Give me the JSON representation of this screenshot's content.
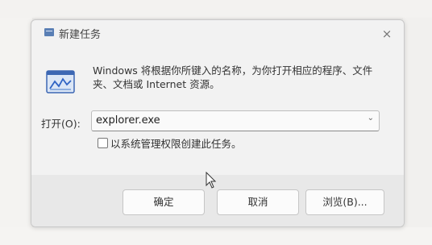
{
  "dialog": {
    "title": "新建任务",
    "close_label": "×",
    "description": "Windows 将根据你所键入的名称，为你打开相应的程序、文件夹、文档或 Internet 资源。",
    "open_label": "打开(O):",
    "open_value": "explorer.exe",
    "admin_checkbox_label": "以系统管理权限创建此任务。",
    "buttons": {
      "ok": "确定",
      "cancel": "取消",
      "browse": "浏览(B)..."
    }
  },
  "colors": {
    "accent": "#2f63c4",
    "dialog_bg": "#f2f2f2"
  },
  "icons": {
    "title": "task-manager-icon",
    "run": "run-program-icon",
    "combo": "chevron-down-icon",
    "close": "close-icon",
    "pointer": "mouse-cursor-icon"
  }
}
